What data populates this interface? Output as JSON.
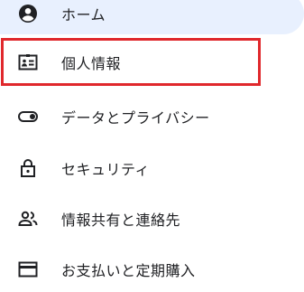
{
  "nav": {
    "items": [
      {
        "label": "ホーム",
        "icon": "account-circle-icon",
        "active": true
      },
      {
        "label": "個人情報",
        "icon": "badge-icon",
        "highlighted": true
      },
      {
        "label": "データとプライバシー",
        "icon": "toggle-icon"
      },
      {
        "label": "セキュリティ",
        "icon": "lock-icon"
      },
      {
        "label": "情報共有と連絡先",
        "icon": "people-icon"
      },
      {
        "label": "お支払いと定期購入",
        "icon": "credit-card-icon"
      }
    ]
  },
  "colors": {
    "active_background": "#e8f0fe",
    "highlight_border": "#e0282c",
    "icon": "#202124",
    "text": "#202124"
  }
}
